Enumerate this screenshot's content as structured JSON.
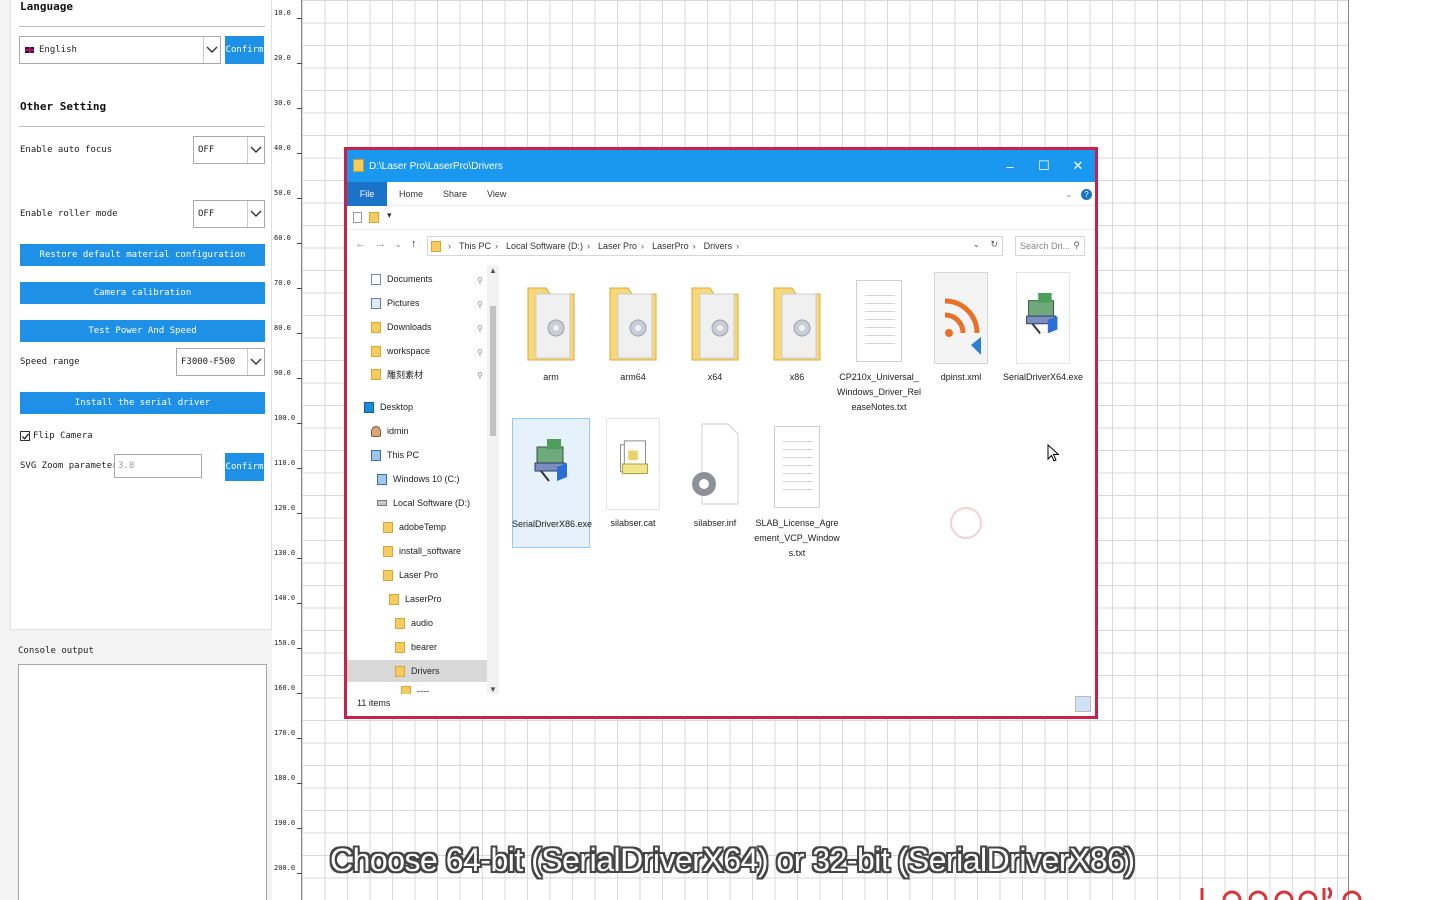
{
  "settings": {
    "language_title": "Language",
    "language_value": "English",
    "language_confirm": "Confirm",
    "other_title": "Other Setting",
    "auto_focus_label": "Enable auto focus",
    "auto_focus_value": "OFF",
    "roller_label": "Enable roller mode",
    "roller_value": "OFF",
    "restore_button": "Restore default material configuration",
    "camera_button": "Camera calibration",
    "test_button": "Test Power And Speed",
    "speed_label": "Speed range",
    "speed_value": "F3000-F500",
    "install_button": "Install the serial driver",
    "flip_label": "Flip Camera",
    "svg_zoom_label": "SVG Zoom parameters:",
    "svg_zoom_value": "3.8",
    "svg_confirm": "Confirm",
    "console_label": "Console output"
  },
  "ruler": [
    "10.0",
    "20.0",
    "30.0",
    "40.0",
    "50.0",
    "60.0",
    "70.0",
    "80.0",
    "90.0",
    "100.0",
    "110.0",
    "120.0",
    "130.0",
    "140.0",
    "150.0",
    "160.0",
    "170.0",
    "180.0",
    "190.0",
    "200.0"
  ],
  "explorer": {
    "title": "D:\\Laser Pro\\LaserPro\\Drivers",
    "ribbon": {
      "file": "File",
      "home": "Home",
      "share": "Share",
      "view": "View"
    },
    "breadcrumbs": [
      "This PC",
      "Local Software (D:)",
      "Laser Pro",
      "LaserPro",
      "Drivers"
    ],
    "search_placeholder": "Search Dri...",
    "nav": {
      "documents": "Documents",
      "pictures": "Pictures",
      "downloads": "Downloads",
      "workspace": "workspace",
      "material": "雕刻素材",
      "desktop": "Desktop",
      "user": "idmin",
      "thispc": "This PC",
      "windows": "Windows 10 (C:)",
      "localsoft": "Local Software (D:)",
      "adobetemp": "adobeTemp",
      "install": "install_software",
      "laserpro1": "Laser Pro",
      "laserpro2": "LaserPro",
      "audio": "audio",
      "bearer": "bearer",
      "drivers": "Drivers",
      "more": "----"
    },
    "files": {
      "arm": "arm",
      "arm64": "arm64",
      "x64": "x64",
      "x86": "x86",
      "cp210x": "CP210x_Universal_Windows_Driver_ReleaseNotes.txt",
      "dpinst": "dpinst.xml",
      "serial64": "SerialDriverX64.exe",
      "serial86": "SerialDriverX86.exe",
      "silabcat": "silabser.cat",
      "silabinf": "silabser.inf",
      "slab": "SLAB_License_Agreement_VCP_Windows.txt"
    },
    "status": "11 items"
  },
  "subtitle": "Choose 64-bit (SerialDriverX64) or 32-bit (SerialDriverX86)",
  "colors": {
    "accent": "#1e90e6",
    "explorer_border": "#c8214a",
    "title_bar": "#1a98f0"
  }
}
